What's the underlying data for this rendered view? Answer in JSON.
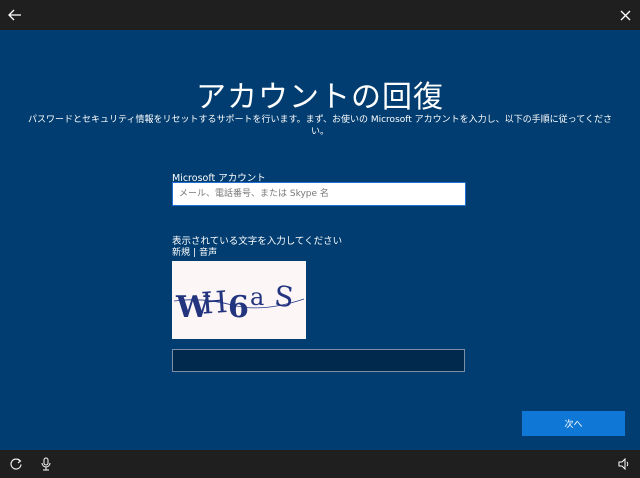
{
  "window": {
    "back_icon": "back-arrow-icon",
    "close_icon": "close-icon"
  },
  "page": {
    "title": "アカウントの回復",
    "description": "パスワードとセキュリティ情報をリセットするサポートを行います。まず、お使いの Microsoft アカウントを入力し、以下の手順に従ってください。"
  },
  "account": {
    "label": "Microsoft アカウント",
    "placeholder": "メール、電話番号、または Skype 名",
    "value": ""
  },
  "captcha": {
    "prompt": "表示されている文字を入力してください",
    "new_link": "新規",
    "separator": "|",
    "audio_link": "音声",
    "image_text": "WH6aS",
    "answer_value": ""
  },
  "actions": {
    "next_label": "次へ"
  },
  "bottom_bar": {
    "icons": [
      "ease-of-access-icon",
      "microphone-icon",
      "volume-icon"
    ]
  },
  "colors": {
    "background": "#013d70",
    "bar": "#1f1f1f",
    "accent": "#0f78d7"
  }
}
